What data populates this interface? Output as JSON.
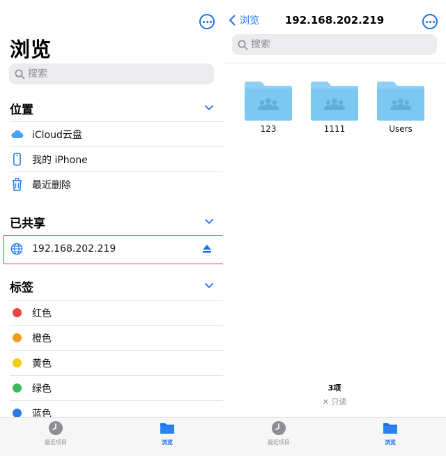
{
  "left": {
    "title": "浏览",
    "search_placeholder": "搜索",
    "locations": {
      "header": "位置",
      "items": [
        {
          "label": "iCloud云盘",
          "icon": "icloud-icon"
        },
        {
          "label": "我的 iPhone",
          "icon": "iphone-icon"
        },
        {
          "label": "最近删除",
          "icon": "trash-icon"
        }
      ]
    },
    "shared": {
      "header": "已共享",
      "items": [
        {
          "label": "192.168.202.219",
          "icon": "globe-icon"
        }
      ]
    },
    "tags": {
      "header": "标签",
      "items": [
        {
          "label": "红色",
          "color": "#e5473d"
        },
        {
          "label": "橙色",
          "color": "#f29b1d"
        },
        {
          "label": "黄色",
          "color": "#f4cc12"
        },
        {
          "label": "绿色",
          "color": "#3fba5a"
        },
        {
          "label": "蓝色",
          "color": "#2a7ae2"
        }
      ]
    },
    "tabbar": [
      {
        "label": "最近项目",
        "icon": "clock-icon"
      },
      {
        "label": "浏览",
        "icon": "folder-icon"
      }
    ]
  },
  "right": {
    "back_label": "浏览",
    "title": "192.168.202.219",
    "search_placeholder": "搜索",
    "folders": [
      {
        "name": "123"
      },
      {
        "name": "1111"
      },
      {
        "name": "Users"
      }
    ],
    "count": "3项",
    "readonly": "只读",
    "tabbar": [
      {
        "label": "最近项目",
        "icon": "clock-icon"
      },
      {
        "label": "浏览",
        "icon": "folder-icon"
      }
    ]
  },
  "colors": {
    "accent": "#1a73e8",
    "highlight_border": "#d8483f",
    "folder_fill": "#7cc8f3"
  }
}
